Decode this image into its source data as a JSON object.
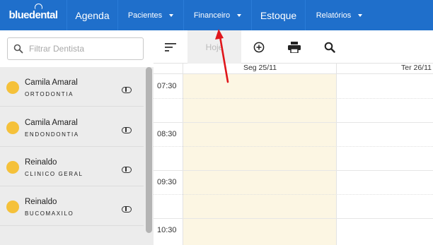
{
  "app": {
    "logo_text": "bluedental"
  },
  "nav": {
    "items": [
      {
        "label": "Agenda",
        "has_dropdown": false
      },
      {
        "label": "Pacientes",
        "has_dropdown": true
      },
      {
        "label": "Financeiro",
        "has_dropdown": true
      },
      {
        "label": "Estoque",
        "has_dropdown": false
      },
      {
        "label": "Relatórios",
        "has_dropdown": true
      }
    ]
  },
  "sidebar": {
    "filter": {
      "placeholder": "Filtrar Dentista",
      "value": ""
    },
    "dentists": [
      {
        "name": "Camila Amaral",
        "specialty": "ORTODONTIA"
      },
      {
        "name": "Camila Amaral",
        "specialty": "ENDONDONTIA"
      },
      {
        "name": "Reinaldo",
        "specialty": "CLINICO GERAL"
      },
      {
        "name": "Reinaldo",
        "specialty": "BUCOMAXILO"
      }
    ]
  },
  "toolbar": {
    "today_label": "Hoje",
    "icons": [
      "sort-lines-icon",
      "add-circle-icon",
      "print-icon",
      "search-icon"
    ]
  },
  "calendar": {
    "days": [
      "Seg 25/11",
      "Ter 26/11"
    ],
    "times": [
      "07:30",
      "08:30",
      "09:30",
      "10:30"
    ]
  },
  "colors": {
    "nav_bg": "#1f6fcb",
    "today_highlight": "#fcf6e3",
    "dentist_dot": "#f5c13a",
    "arrow": "#e0161b",
    "sidebar_bg": "#ececec"
  }
}
